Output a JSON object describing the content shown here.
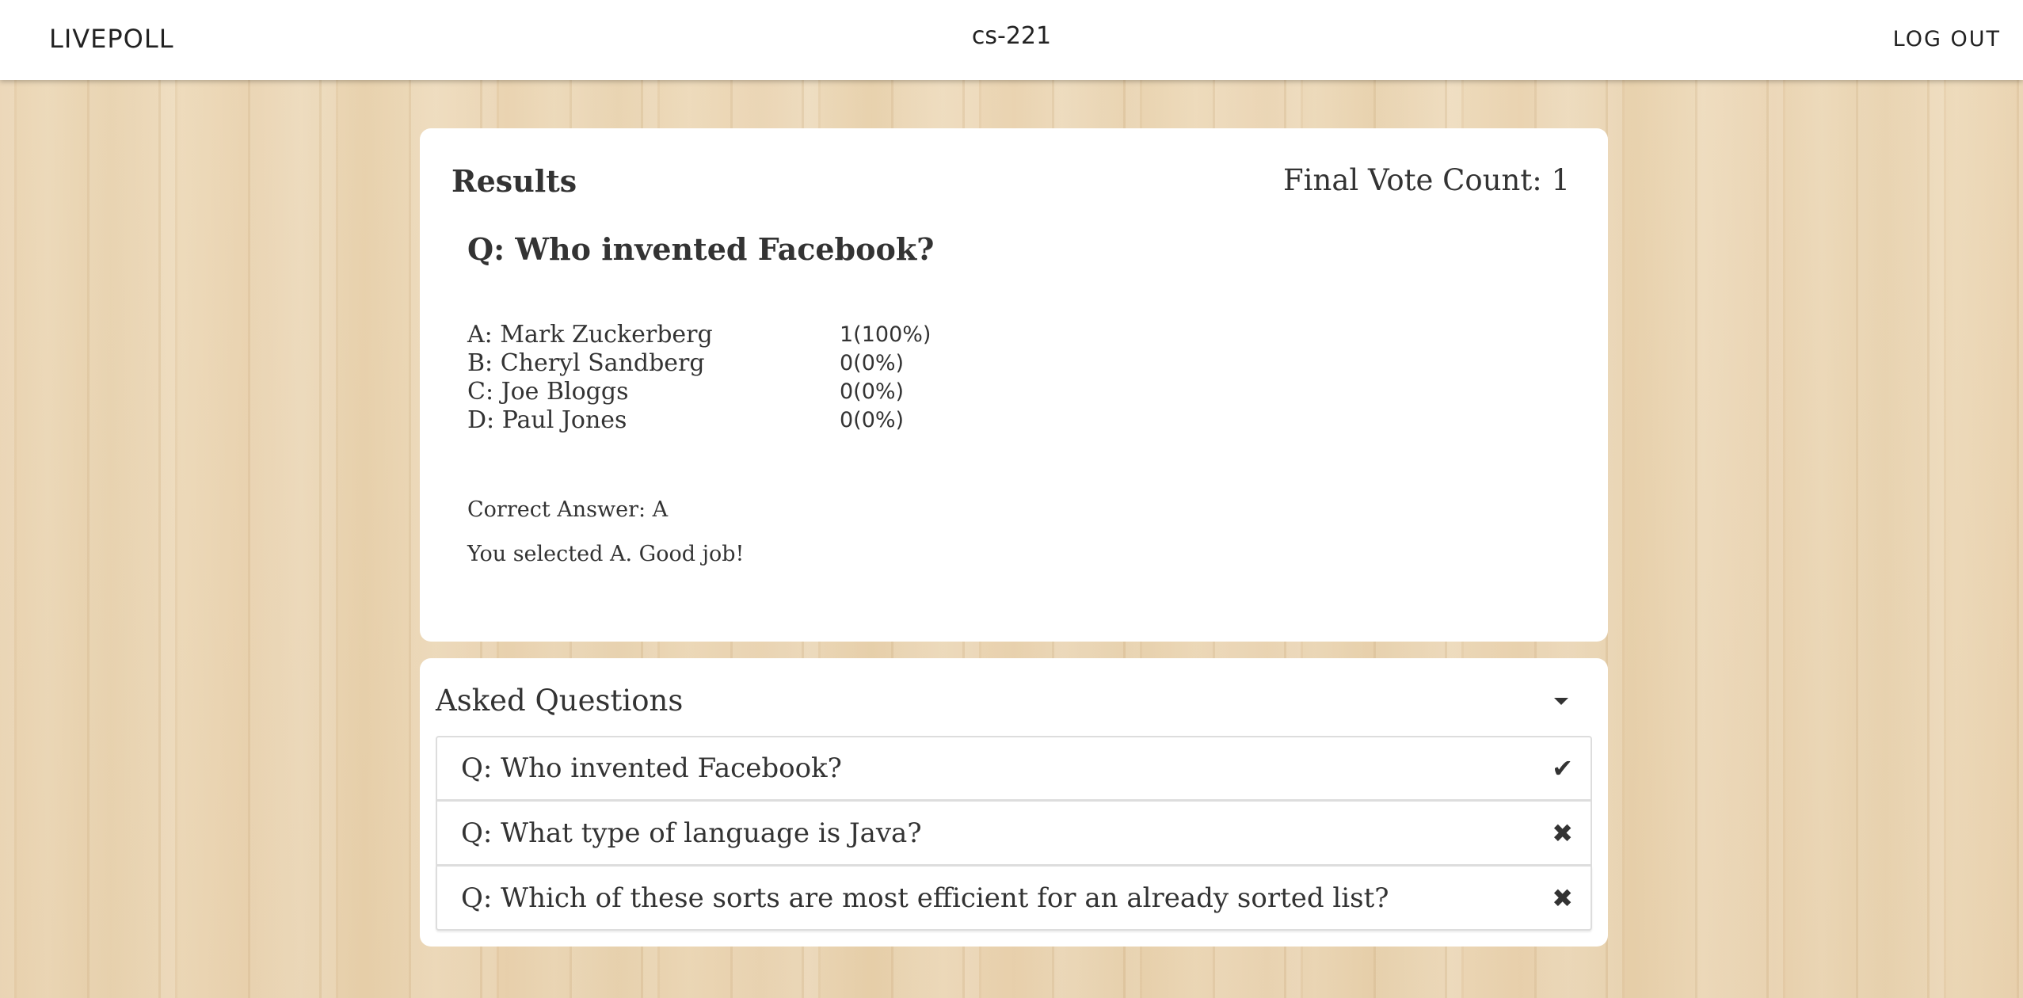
{
  "navbar": {
    "brand": "LIVEPOLL",
    "course": "cs-221",
    "logout_label": "LOG OUT"
  },
  "results": {
    "title": "Results",
    "vote_count": "Final Vote Count: 1",
    "question": "Q: Who invented Facebook?",
    "answers": [
      {
        "label": "A: Mark Zuckerberg",
        "count": "1(100%)"
      },
      {
        "label": "B: Cheryl Sandberg",
        "count": "0(0%)"
      },
      {
        "label": "C: Joe Bloggs",
        "count": "0(0%)"
      },
      {
        "label": "D: Paul Jones",
        "count": "0(0%)"
      }
    ],
    "correct_answer": "Correct Answer: A",
    "feedback": "You selected A. Good job!"
  },
  "asked": {
    "title": "Asked Questions",
    "questions": [
      {
        "text": "Q: Who invented Facebook?",
        "status_icon": "check-icon",
        "status_glyph": "✔"
      },
      {
        "text": "Q: What type of language is Java?",
        "status_icon": "cross-icon",
        "status_glyph": "✖"
      },
      {
        "text": "Q: Which of these sorts are most efficient for an already sorted list?",
        "status_icon": "cross-icon",
        "status_glyph": "✖"
      }
    ]
  }
}
